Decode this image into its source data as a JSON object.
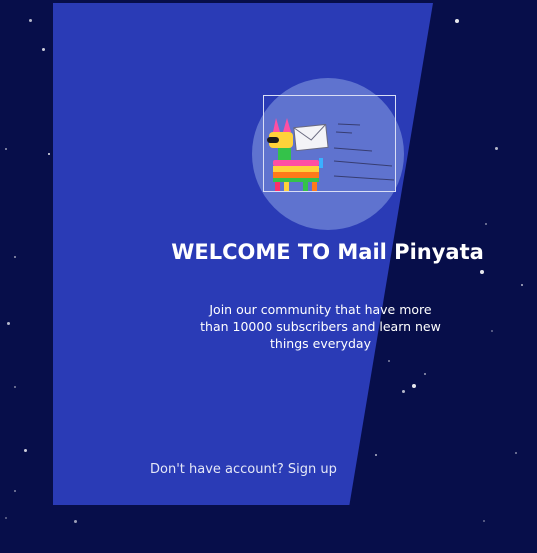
{
  "welcome": {
    "title": "WELCOME TO Mail Pinyata",
    "subtitle": "Join our community that have more than 10000 subscribers and learn new things everyday"
  },
  "signup": {
    "prompt": "Don't have account?",
    "link_label": "Sign up"
  },
  "logo": {
    "icon": "pinata-mail-logo"
  },
  "colors": {
    "background": "#070e4a",
    "panel": "#2a3bb6",
    "circle": "#5f73cf",
    "text": "#ffffff"
  }
}
